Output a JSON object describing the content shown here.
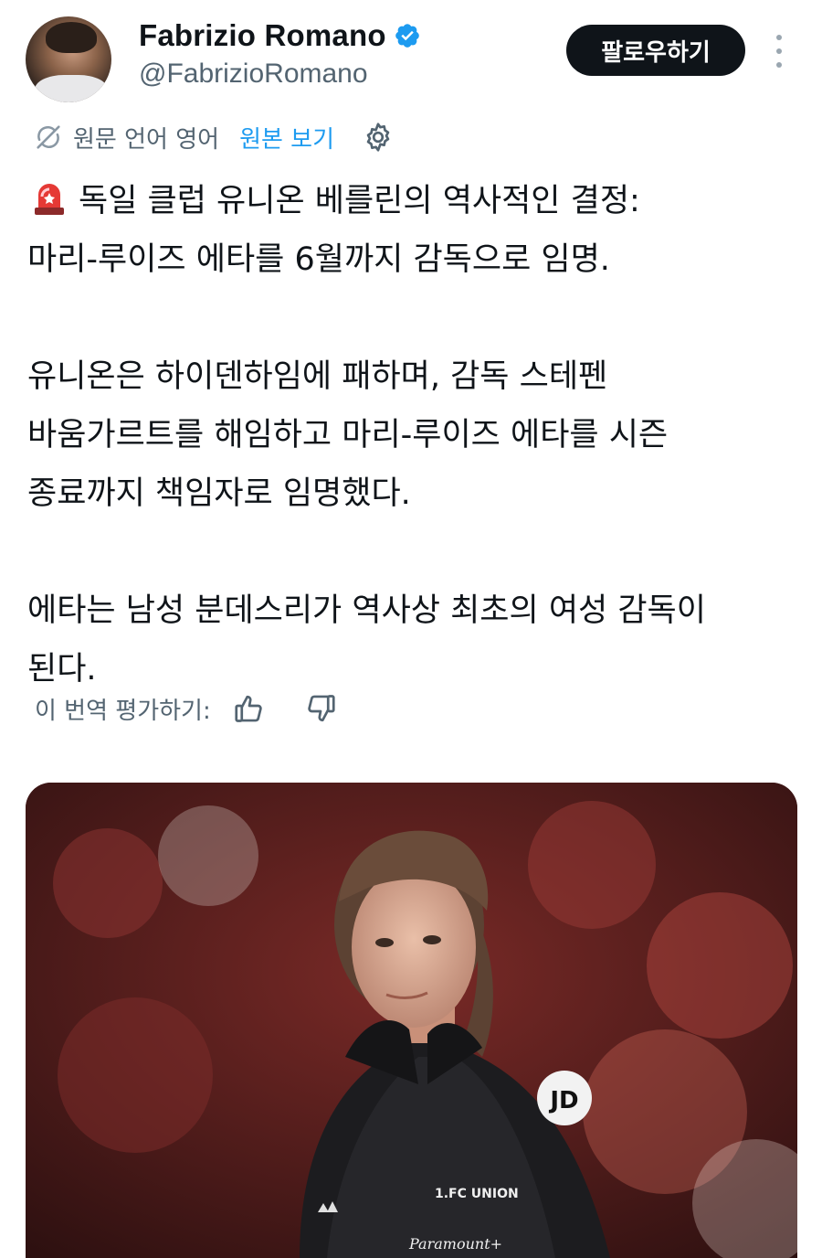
{
  "author": {
    "display_name": "Fabrizio Romano",
    "handle": "@FabrizioRomano",
    "verified": true,
    "avatar_icon": "avatar-photo"
  },
  "actions": {
    "follow_label": "팔로우하기",
    "more_icon": "more-vertical-icon"
  },
  "translation": {
    "original_language": "원문 언어 영어",
    "view_original": "원본 보기",
    "settings_icon": "gear-icon"
  },
  "tweet": {
    "paragraph1": "독일 클럽 유니온 베를린의 역사적인 결정:\n마리-루이즈 에타를 6월까지 감독으로 임명.",
    "paragraph2": "유니온은 하이덴하임에 패하며, 감독 스테펜\n바움가르트를 해임하고 마리-루이즈 에타를 시즌\n종료까지 책임자로 임명했다.",
    "paragraph3": "에타는 남성 분데스리가 역사상 최초의 여성 감독이\n된다.",
    "emoji_icon": "police-light-icon"
  },
  "rating": {
    "label": "이 번역 평가하기:",
    "thumbs_up_icon": "thumbs-up-icon",
    "thumbs_down_icon": "thumbs-down-icon"
  },
  "media": {
    "type": "photo",
    "jacket_text": "JD",
    "crest_text": "1.FC UNION",
    "sponsor_text": "Paramount+"
  },
  "colors": {
    "text": "#0f1419",
    "secondary": "#536471",
    "link": "#1d9bf0",
    "verified": "#1d9bf0",
    "button_bg": "#0f1419"
  }
}
